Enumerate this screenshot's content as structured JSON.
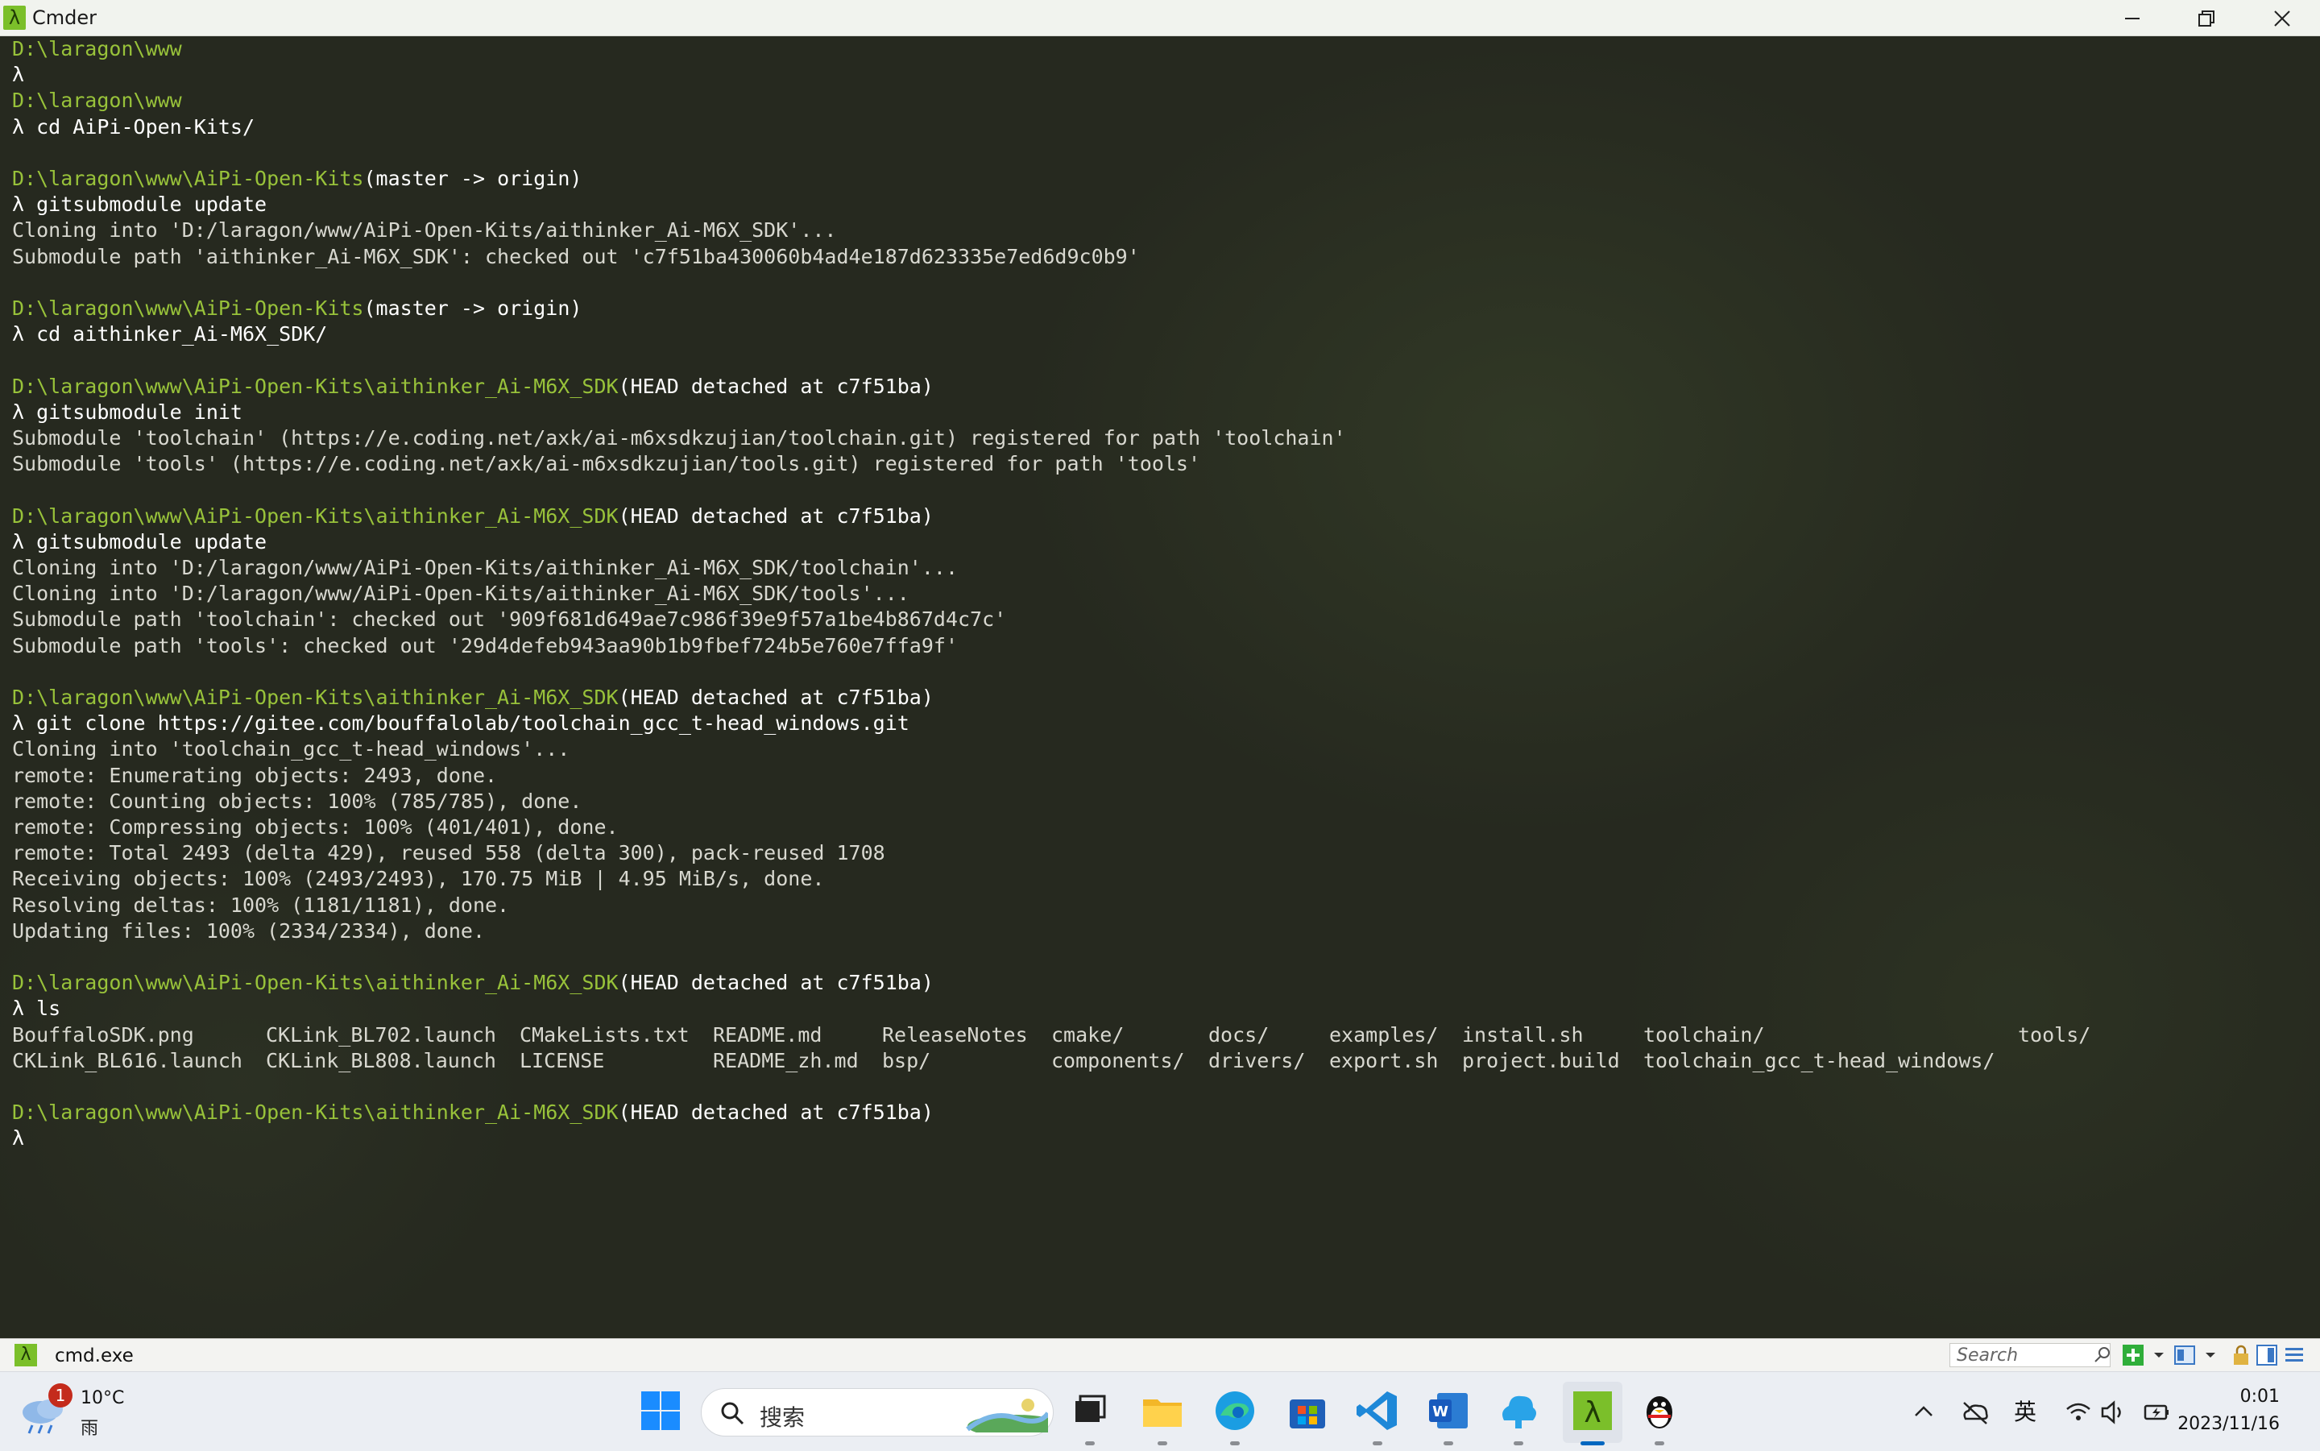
{
  "window": {
    "title": "Cmder",
    "app_icon": "λ",
    "controls": [
      "minimize-icon",
      "restore-icon",
      "close-icon"
    ]
  },
  "terminal": {
    "lines": [
      {
        "path": "D:\\laragon\\www",
        "suffix": ""
      },
      {
        "lambda": "λ",
        "cmd": ""
      },
      {
        "path": "D:\\laragon\\www",
        "suffix": ""
      },
      {
        "lambda": "λ",
        "cmd": " cd AiPi-Open-Kits/"
      },
      {
        "blank": true
      },
      {
        "path": "D:\\laragon\\www\\AiPi-Open-Kits",
        "suffix": "(master -> origin)"
      },
      {
        "lambda": "λ",
        "cmd": " gitsubmodule update"
      },
      {
        "text": "Cloning into 'D:/laragon/www/AiPi-Open-Kits/aithinker_Ai-M6X_SDK'..."
      },
      {
        "text": "Submodule path 'aithinker_Ai-M6X_SDK': checked out 'c7f51ba430060b4ad4e187d623335e7ed6d9c0b9'"
      },
      {
        "blank": true
      },
      {
        "path": "D:\\laragon\\www\\AiPi-Open-Kits",
        "suffix": "(master -> origin)"
      },
      {
        "lambda": "λ",
        "cmd": " cd aithinker_Ai-M6X_SDK/"
      },
      {
        "blank": true
      },
      {
        "path": "D:\\laragon\\www\\AiPi-Open-Kits\\aithinker_Ai-M6X_SDK",
        "suffix": "(HEAD detached at c7f51ba)"
      },
      {
        "lambda": "λ",
        "cmd": " gitsubmodule init"
      },
      {
        "text": "Submodule 'toolchain' (https://e.coding.net/axk/ai-m6xsdkzujian/toolchain.git) registered for path 'toolchain'"
      },
      {
        "text": "Submodule 'tools' (https://e.coding.net/axk/ai-m6xsdkzujian/tools.git) registered for path 'tools'"
      },
      {
        "blank": true
      },
      {
        "path": "D:\\laragon\\www\\AiPi-Open-Kits\\aithinker_Ai-M6X_SDK",
        "suffix": "(HEAD detached at c7f51ba)"
      },
      {
        "lambda": "λ",
        "cmd": " gitsubmodule update"
      },
      {
        "text": "Cloning into 'D:/laragon/www/AiPi-Open-Kits/aithinker_Ai-M6X_SDK/toolchain'..."
      },
      {
        "text": "Cloning into 'D:/laragon/www/AiPi-Open-Kits/aithinker_Ai-M6X_SDK/tools'..."
      },
      {
        "text": "Submodule path 'toolchain': checked out '909f681d649ae7c986f39e9f57a1be4b867d4c7c'"
      },
      {
        "text": "Submodule path 'tools': checked out '29d4defeb943aa90b1b9fbef724b5e760e7ffa9f'"
      },
      {
        "blank": true
      },
      {
        "path": "D:\\laragon\\www\\AiPi-Open-Kits\\aithinker_Ai-M6X_SDK",
        "suffix": "(HEAD detached at c7f51ba)"
      },
      {
        "lambda": "λ",
        "cmd": " git clone https://gitee.com/bouffalolab/toolchain_gcc_t-head_windows.git"
      },
      {
        "text": "Cloning into 'toolchain_gcc_t-head_windows'..."
      },
      {
        "text": "remote: Enumerating objects: 2493, done."
      },
      {
        "text": "remote: Counting objects: 100% (785/785), done."
      },
      {
        "text": "remote: Compressing objects: 100% (401/401), done."
      },
      {
        "text": "remote: Total 2493 (delta 429), reused 558 (delta 300), pack-reused 1708"
      },
      {
        "text": "Receiving objects: 100% (2493/2493), 170.75 MiB | 4.95 MiB/s, done."
      },
      {
        "text": "Resolving deltas: 100% (1181/1181), done."
      },
      {
        "text": "Updating files: 100% (2334/2334), done."
      },
      {
        "blank": true
      },
      {
        "path": "D:\\laragon\\www\\AiPi-Open-Kits\\aithinker_Ai-M6X_SDK",
        "suffix": "(HEAD detached at c7f51ba)"
      },
      {
        "lambda": "λ",
        "cmd": " ls"
      },
      {
        "ls_row": 0
      },
      {
        "ls_row": 1
      },
      {
        "blank": true
      },
      {
        "path": "D:\\laragon\\www\\AiPi-Open-Kits\\aithinker_Ai-M6X_SDK",
        "suffix": "(HEAD detached at c7f51ba)"
      },
      {
        "lambda": "λ",
        "cmd": ""
      }
    ],
    "ls_rows": [
      [
        {
          "name": "BouffaloSDK.png",
          "dir": false
        },
        {
          "name": "CKLink_BL702.launch",
          "dir": false
        },
        {
          "name": "CMakeLists.txt",
          "dir": false
        },
        {
          "name": "README.md",
          "dir": false
        },
        {
          "name": "ReleaseNotes",
          "dir": false
        },
        {
          "name": "cmake/",
          "dir": true
        },
        {
          "name": "docs/",
          "dir": true
        },
        {
          "name": "examples/",
          "dir": true
        },
        {
          "name": "install.sh",
          "dir": false
        },
        {
          "name": "toolchain/",
          "dir": true
        },
        {
          "name": "tools/",
          "dir": true
        }
      ],
      [
        {
          "name": "CKLink_BL616.launch",
          "dir": false
        },
        {
          "name": "CKLink_BL808.launch",
          "dir": false
        },
        {
          "name": "LICENSE",
          "dir": false
        },
        {
          "name": "README_zh.md",
          "dir": false
        },
        {
          "name": "bsp/",
          "dir": true
        },
        {
          "name": "components/",
          "dir": true
        },
        {
          "name": "drivers/",
          "dir": true
        },
        {
          "name": "export.sh",
          "dir": false
        },
        {
          "name": "project.build",
          "dir": false
        },
        {
          "name": "toolchain_gcc_t-head_windows/",
          "dir": true
        }
      ]
    ]
  },
  "tabbar": {
    "tab_icon": "λ",
    "tab_label": "cmd.exe",
    "search_placeholder": "Search"
  },
  "taskbar": {
    "weather_temp": "10°C",
    "weather_condition": "雨",
    "weather_badge": "1",
    "search_placeholder": "搜索",
    "ime_label": "英",
    "time": "0:01",
    "date": "2023/11/16",
    "colors": {
      "accent": "#0067c0",
      "cmder_green": "#7bbf2a"
    }
  }
}
